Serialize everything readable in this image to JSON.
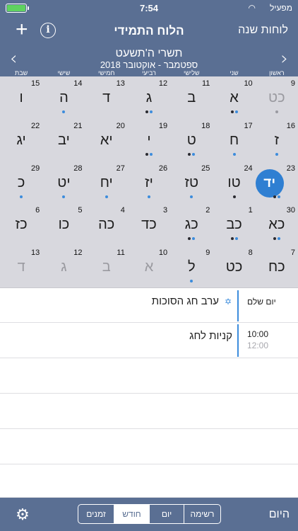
{
  "status": {
    "time": "7:54",
    "carrier": "מפעיל"
  },
  "nav": {
    "title": "הלוח התמידי",
    "years_label": "לוחות שנה",
    "plus_label": "+",
    "info_label": "i"
  },
  "month": {
    "hebrew": "תשרי ה'תשעט",
    "gregorian": "ספטמבר - אוקטובר 2018",
    "prev_label": "‹",
    "next_label": "›"
  },
  "weekdays": [
    "ראשון",
    "שני",
    "שלישי",
    "רביעי",
    "חמישי",
    "שישי",
    "שבת"
  ],
  "weeks": [
    [
      {
        "g": "9",
        "h": "כט",
        "dim": true,
        "dots": [
          "gray"
        ]
      },
      {
        "g": "10",
        "h": "א",
        "dots": [
          "dark",
          "blue"
        ]
      },
      {
        "g": "11",
        "h": "ב",
        "dots": []
      },
      {
        "g": "12",
        "h": "ג",
        "dots": [
          "dark",
          "blue"
        ]
      },
      {
        "g": "13",
        "h": "ד",
        "dots": []
      },
      {
        "g": "14",
        "h": "ה",
        "dots": [
          "blue"
        ]
      },
      {
        "g": "15",
        "h": "ו",
        "dots": []
      }
    ],
    [
      {
        "g": "16",
        "h": "ז",
        "dots": [
          "blue"
        ]
      },
      {
        "g": "17",
        "h": "ח",
        "dots": [
          "blue"
        ]
      },
      {
        "g": "18",
        "h": "ט",
        "dots": [
          "dark",
          "blue"
        ]
      },
      {
        "g": "19",
        "h": "י",
        "dots": [
          "dark",
          "blue"
        ]
      },
      {
        "g": "20",
        "h": "יא",
        "dots": []
      },
      {
        "g": "21",
        "h": "יב",
        "dots": []
      },
      {
        "g": "22",
        "h": "יג",
        "dots": []
      }
    ],
    [
      {
        "g": "23",
        "h": "יד",
        "today": true,
        "dots": [
          "dark",
          "blue"
        ]
      },
      {
        "g": "24",
        "h": "טו",
        "dots": [
          "dark"
        ]
      },
      {
        "g": "25",
        "h": "טז",
        "dots": [
          "blue"
        ]
      },
      {
        "g": "26",
        "h": "יז",
        "dots": [
          "blue"
        ]
      },
      {
        "g": "27",
        "h": "יח",
        "dots": [
          "blue"
        ]
      },
      {
        "g": "28",
        "h": "יט",
        "dots": [
          "blue"
        ]
      },
      {
        "g": "29",
        "h": "כ",
        "dots": [
          "blue"
        ]
      }
    ],
    [
      {
        "g": "30",
        "h": "כא",
        "dots": [
          "dark",
          "blue"
        ]
      },
      {
        "g": "1",
        "h": "כב",
        "dots": [
          "dark",
          "blue"
        ]
      },
      {
        "g": "2",
        "h": "כג",
        "dots": [
          "dark",
          "blue"
        ]
      },
      {
        "g": "3",
        "h": "כד",
        "dots": []
      },
      {
        "g": "4",
        "h": "כה",
        "dots": []
      },
      {
        "g": "5",
        "h": "כו",
        "dots": []
      },
      {
        "g": "6",
        "h": "כז",
        "dots": []
      }
    ],
    [
      {
        "g": "7",
        "h": "כח",
        "dots": []
      },
      {
        "g": "8",
        "h": "כט",
        "dots": []
      },
      {
        "g": "9",
        "h": "ל",
        "dots": [
          "blue"
        ]
      },
      {
        "g": "10",
        "h": "א",
        "dim": true,
        "dots": []
      },
      {
        "g": "11",
        "h": "ב",
        "dim": true,
        "dots": []
      },
      {
        "g": "12",
        "h": "ג",
        "dim": true,
        "dots": []
      },
      {
        "g": "13",
        "h": "ד",
        "dim": true,
        "dots": []
      }
    ]
  ],
  "events": [
    {
      "time1": "יום שלם",
      "time2": "",
      "title": "ערב חג הסוכות",
      "star": "✡"
    },
    {
      "time1": "10:00",
      "time2": "12:00",
      "title": "קניות לחג",
      "star": ""
    }
  ],
  "tabbar": {
    "today_label": "היום",
    "gear_icon": "gear-icon",
    "segments": [
      {
        "label": "זמנים",
        "active": false
      },
      {
        "label": "חודש",
        "active": true
      },
      {
        "label": "יום",
        "active": false
      },
      {
        "label": "רשימה",
        "active": false
      }
    ]
  },
  "colors": {
    "header": "#5a6f93",
    "accent": "#2f7fd2",
    "grid_bg": "#d8d8de"
  }
}
